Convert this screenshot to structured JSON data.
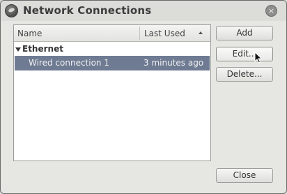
{
  "window": {
    "title": "Network Connections",
    "close_glyph": "×"
  },
  "list": {
    "columns": {
      "name": "Name",
      "last_used": "Last Used"
    },
    "sort": "ascending",
    "groups": [
      {
        "label": "Ethernet",
        "expanded": true,
        "connections": [
          {
            "name": "Wired connection 1",
            "last_used": "3 minutes ago",
            "selected": true
          }
        ]
      }
    ]
  },
  "buttons": {
    "add": "Add",
    "edit": "Edit...",
    "delete": "Delete...",
    "close": "Close"
  },
  "colors": {
    "selection": "#6e7b92",
    "window_bg": "#e6e6e3"
  },
  "icons": {
    "title": "network-icon",
    "cursor": "mouse-pointer-icon"
  }
}
